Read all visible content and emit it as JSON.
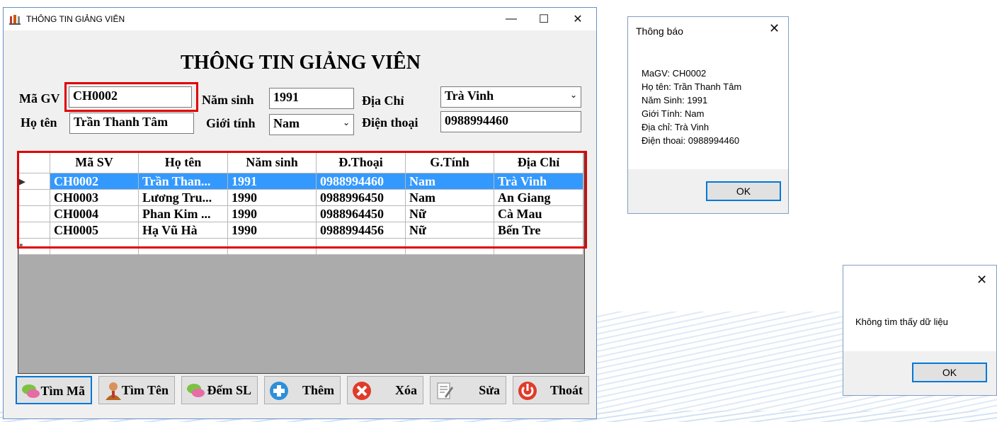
{
  "window": {
    "title": "THÔNG TIN GIẢNG VIÊN",
    "minimize": "—",
    "maximize": "☐",
    "close": "✕"
  },
  "form": {
    "heading": "THÔNG TIN GIẢNG VIÊN",
    "ma_gv_label": "Mã GV",
    "ma_gv_value": "CH0002",
    "nam_sinh_label": "Năm sinh",
    "nam_sinh_value": "1991",
    "dia_chi_label": "Địa Chỉ",
    "dia_chi_value": "Trà Vinh",
    "ho_ten_label": "Họ tên",
    "ho_ten_value": "Trần Thanh Tâm",
    "gioi_tinh_label": "Giới tính",
    "gioi_tinh_value": "Nam",
    "dien_thoai_label": "Điện thoại",
    "dien_thoai_value": "0988994460"
  },
  "grid": {
    "columns": [
      "Mã SV",
      "Họ tên",
      "Năm sinh",
      "Đ.Thoại",
      "G.Tính",
      "Địa Chỉ"
    ],
    "rows": [
      [
        "CH0002",
        "Trần Than...",
        "1991",
        "0988994460",
        "Nam",
        "Trà Vinh"
      ],
      [
        "CH0003",
        "Lương Tru...",
        "1990",
        "0988996450",
        "Nam",
        "An Giang"
      ],
      [
        "CH0004",
        "Phan Kim ...",
        "1990",
        "0988964450",
        "Nữ",
        "Cà Mau"
      ],
      [
        "CH0005",
        "Hạ Vũ Hà",
        "1990",
        "0988994456",
        "Nữ",
        "Bến Tre"
      ]
    ],
    "current_row_marker": "▶",
    "new_row_marker": "*"
  },
  "buttons": {
    "tim_ma": "Tìm Mã",
    "tim_ten": "Tìm Tên",
    "dem_sl": "Đếm SL",
    "them": "Thêm",
    "xoa": "Xóa",
    "sua": "Sửa",
    "thoat": "Thoát"
  },
  "dialog_info": {
    "title": "Thông báo",
    "close": "✕",
    "lines": [
      "MaGV: CH0002",
      "Họ tên: Trần Thanh Tâm",
      "Năm Sinh: 1991",
      "Giới Tính: Nam",
      "Địa chỉ: Trà Vinh",
      "Điện thoai: 0988994460"
    ],
    "ok": "OK"
  },
  "dialog_notfound": {
    "close": "✕",
    "message": "Không tìm thấy dữ liệu",
    "ok": "OK"
  },
  "colors": {
    "selection": "#3399ff",
    "highlight_box": "#e00000",
    "focus_border": "#0078d7"
  }
}
